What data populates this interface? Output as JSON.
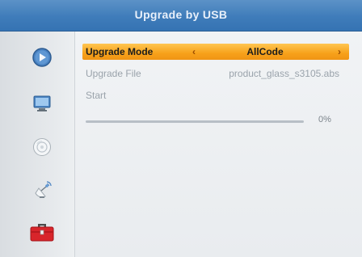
{
  "window": {
    "title": "Upgrade by USB"
  },
  "sidebar": {
    "items": [
      {
        "icon": "play-icon"
      },
      {
        "icon": "tv-screen-icon"
      },
      {
        "icon": "disc-icon"
      },
      {
        "icon": "satellite-dish-icon"
      },
      {
        "icon": "toolbox-icon",
        "selected": true
      }
    ]
  },
  "menu": {
    "upgrade_mode": {
      "label": "Upgrade Mode",
      "value": "AllCode"
    },
    "upgrade_file": {
      "label": "Upgrade File",
      "value": "product_glass_s3105.abs"
    },
    "start": {
      "label": "Start"
    }
  },
  "progress": {
    "value": 0,
    "text": "0%"
  },
  "colors": {
    "title_bar": "#3f7cba",
    "highlight": "#f7a11a",
    "inactive_text": "#9aa3ab"
  }
}
